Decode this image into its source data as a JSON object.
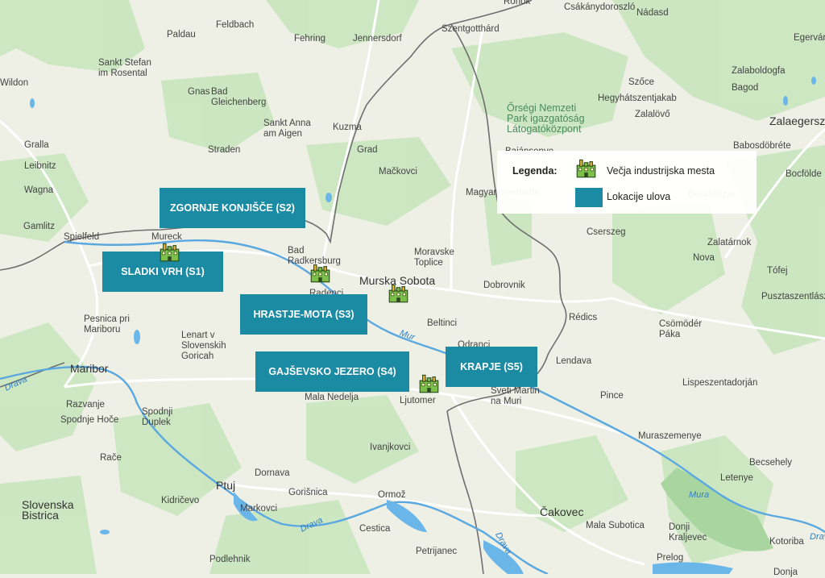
{
  "map": {
    "colors": {
      "land": "#eef0e6",
      "forest": "#c7e4be",
      "water": "#6bb6e8",
      "river": "#5aa8e0",
      "border": "#6f6f6f",
      "road": "#ffffff",
      "site": "#1b8aa3"
    },
    "places": [
      {
        "name": "Paldau",
        "cls": ""
      },
      {
        "name": "Feldbach",
        "cls": ""
      },
      {
        "name": "Fehring",
        "cls": ""
      },
      {
        "name": "Jennersdorf",
        "cls": ""
      },
      {
        "name": "Szentgotthárd",
        "cls": ""
      },
      {
        "name": "Rönök",
        "cls": ""
      },
      {
        "name": "Csákánydoroszló",
        "cls": ""
      },
      {
        "name": "Nádasd",
        "cls": ""
      },
      {
        "name": "Egervár",
        "cls": ""
      },
      {
        "name": "Sankt Stefan\nim Rosental",
        "cls": ""
      },
      {
        "name": "Wildon",
        "cls": ""
      },
      {
        "name": "Gnas",
        "cls": ""
      },
      {
        "name": "Bad\nGleichenberg",
        "cls": ""
      },
      {
        "name": "Zalaboldogfa",
        "cls": ""
      },
      {
        "name": "Szőce",
        "cls": ""
      },
      {
        "name": "Bagod",
        "cls": ""
      },
      {
        "name": "Hegyhátszentjakab",
        "cls": ""
      },
      {
        "name": "Zalalövő",
        "cls": ""
      },
      {
        "name": "Zalaegersz",
        "cls": "city"
      },
      {
        "name": "Sankt Anna\nam Aigen",
        "cls": ""
      },
      {
        "name": "Kuzma",
        "cls": ""
      },
      {
        "name": "Gralla",
        "cls": ""
      },
      {
        "name": "Straden",
        "cls": ""
      },
      {
        "name": "Grad",
        "cls": ""
      },
      {
        "name": "Babosdöbréte",
        "cls": ""
      },
      {
        "name": "Leibnitz",
        "cls": ""
      },
      {
        "name": "Mačkovci",
        "cls": ""
      },
      {
        "name": "Bocfölde",
        "cls": ""
      },
      {
        "name": "Wagna",
        "cls": ""
      },
      {
        "name": "Gamlitz",
        "cls": ""
      },
      {
        "name": "Spielfeld",
        "cls": ""
      },
      {
        "name": "Mureck",
        "cls": ""
      },
      {
        "name": "Bad\nRadkersburg",
        "cls": ""
      },
      {
        "name": "Moravske\nToplice",
        "cls": ""
      },
      {
        "name": "Cserszeg",
        "cls": ""
      },
      {
        "name": "Zalatárnok",
        "cls": ""
      },
      {
        "name": "Nova",
        "cls": ""
      },
      {
        "name": "Tófej",
        "cls": ""
      },
      {
        "name": "Radenci",
        "cls": ""
      },
      {
        "name": "Murska Sobota",
        "cls": "city"
      },
      {
        "name": "Dobrovnik",
        "cls": ""
      },
      {
        "name": "Pusztaszentlászló",
        "cls": ""
      },
      {
        "name": "Pesnica pri\nMariboru",
        "cls": ""
      },
      {
        "name": "Rédics",
        "cls": ""
      },
      {
        "name": "Beltinci",
        "cls": ""
      },
      {
        "name": "Csömödér\nPáka",
        "cls": ""
      },
      {
        "name": "Lenart v\nSlovenskih\nGoricah",
        "cls": ""
      },
      {
        "name": "Odranci",
        "cls": ""
      },
      {
        "name": "Lendava",
        "cls": ""
      },
      {
        "name": "Maribor",
        "cls": "city"
      },
      {
        "name": "Lispeszentadorján",
        "cls": ""
      },
      {
        "name": "Razvanje",
        "cls": ""
      },
      {
        "name": "Mala Nedelja",
        "cls": ""
      },
      {
        "name": "Ljutomer",
        "cls": ""
      },
      {
        "name": "Sveti Martin\nna Muri",
        "cls": ""
      },
      {
        "name": "Pince",
        "cls": ""
      },
      {
        "name": "Spodnje Hoče",
        "cls": ""
      },
      {
        "name": "Spodnji\nDuplek",
        "cls": ""
      },
      {
        "name": "Muraszemenye",
        "cls": ""
      },
      {
        "name": "Ivanjkovci",
        "cls": ""
      },
      {
        "name": "Rače",
        "cls": ""
      },
      {
        "name": "Becsehely",
        "cls": ""
      },
      {
        "name": "Dornava",
        "cls": ""
      },
      {
        "name": "Letenye",
        "cls": ""
      },
      {
        "name": "Ptuj",
        "cls": "city"
      },
      {
        "name": "Gorišnica",
        "cls": ""
      },
      {
        "name": "Ormož",
        "cls": ""
      },
      {
        "name": "Slovenska\nBistrica",
        "cls": "city"
      },
      {
        "name": "Kidričevo",
        "cls": ""
      },
      {
        "name": "Markovci",
        "cls": ""
      },
      {
        "name": "Čakovec",
        "cls": "city"
      },
      {
        "name": "Mala Subotica",
        "cls": ""
      },
      {
        "name": "Donji\nKraljevec",
        "cls": ""
      },
      {
        "name": "Cestica",
        "cls": ""
      },
      {
        "name": "Kotoriba",
        "cls": ""
      },
      {
        "name": "Podlehnik",
        "cls": ""
      },
      {
        "name": "Petrijanec",
        "cls": ""
      },
      {
        "name": "Prelog",
        "cls": ""
      },
      {
        "name": "Donja",
        "cls": ""
      },
      {
        "name": "Őrségi Nemzeti\nPark igazgatóság\nLátogatóközpont",
        "cls": "park"
      },
      {
        "name": "Bajánsenye",
        "cls": ""
      },
      {
        "name": "Magyarszombatfa",
        "cls": ""
      },
      {
        "name": "Becsvölgye",
        "cls": ""
      }
    ],
    "rivers": [
      "Mur",
      "Mura",
      "Drava",
      "Drava",
      "Drava",
      "Drava"
    ]
  },
  "sites": [
    {
      "label": "ZGORNJE KONJIŠČE (S2)"
    },
    {
      "label": "SLADKI VRH (S1)"
    },
    {
      "label": "HRASTJE-MOTA (S3)"
    },
    {
      "label": "GAJŠEVSKO JEZERO (S4)"
    },
    {
      "label": "KRAPJE (S5)"
    }
  ],
  "factories_count": 5,
  "legend": {
    "title": "Legenda:",
    "industrial_label": "Večja industrijska mesta",
    "catch_label": "Lokacije ulova",
    "industrial_icon": "factory-icon",
    "catch_color": "#1b8aa3"
  }
}
